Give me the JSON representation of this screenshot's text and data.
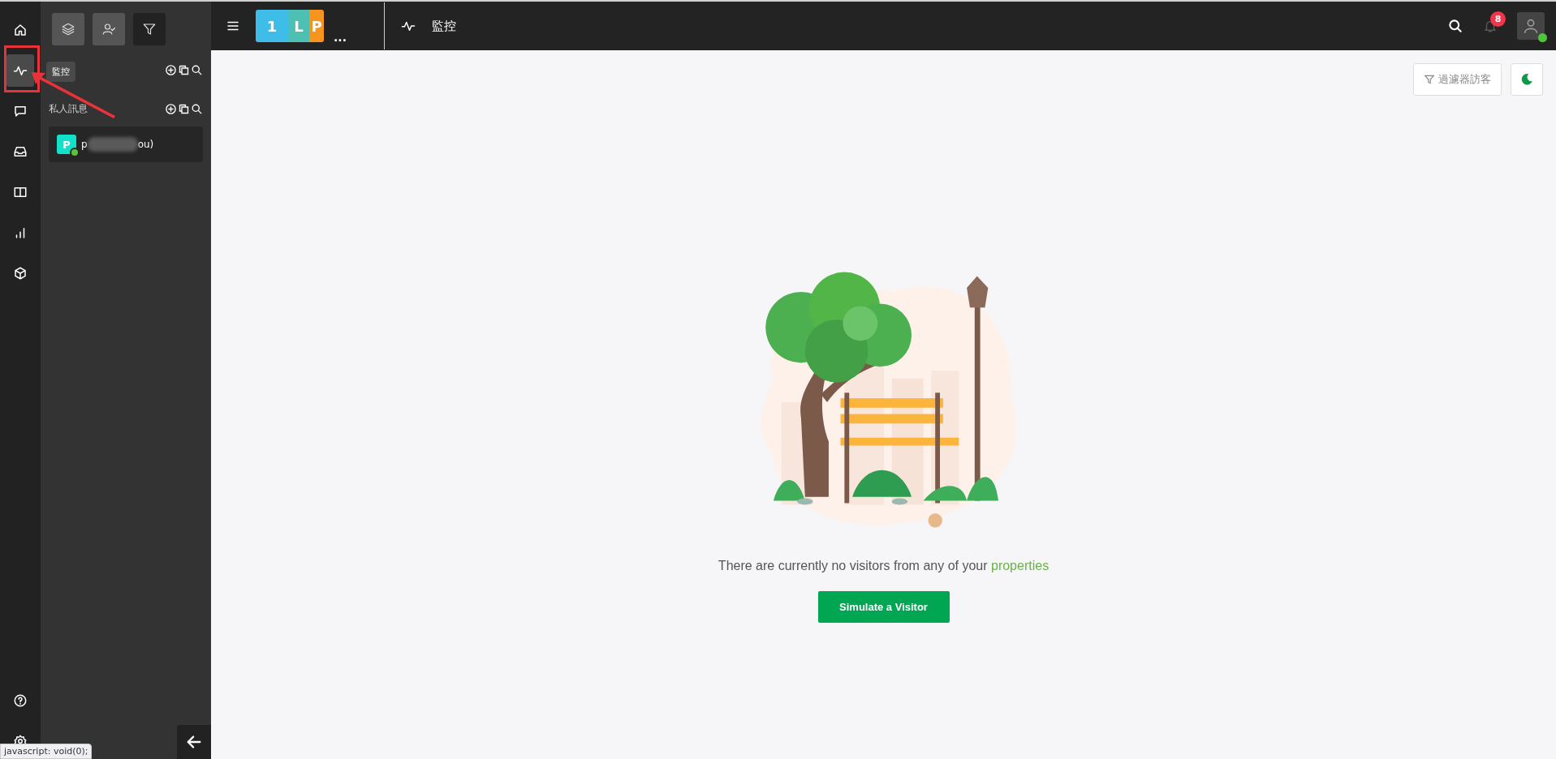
{
  "rail": {
    "items": [
      {
        "kind": "home",
        "selected": false
      },
      {
        "kind": "pulse",
        "selected": true
      },
      {
        "kind": "chat",
        "selected": false
      },
      {
        "kind": "inbox",
        "selected": false
      },
      {
        "kind": "book",
        "selected": false
      },
      {
        "kind": "chart",
        "selected": false
      },
      {
        "kind": "cube",
        "selected": false
      }
    ],
    "bottom_items": [
      {
        "kind": "help",
        "selected": false
      },
      {
        "kind": "settings",
        "selected": false
      }
    ]
  },
  "tooltip": "監控",
  "panel": {
    "tool_buttons": [
      {
        "kind": "layers",
        "on": true
      },
      {
        "kind": "user-check",
        "on": true
      },
      {
        "kind": "filter",
        "on": false
      }
    ],
    "sections": [
      {
        "title": "私人訊息",
        "conversations": [
          {
            "avatar": "P",
            "name_start": "p",
            "name_end": "ou)",
            "online": true
          }
        ]
      }
    ]
  },
  "topbar": {
    "logo": [
      {
        "letter": "1",
        "color": "#3fbde9"
      },
      {
        "letter": "L",
        "color": "#4dbfb3"
      },
      {
        "letter": "P",
        "color": "#f7941d"
      }
    ],
    "more": "...",
    "title": "監控",
    "notifications": "8"
  },
  "content": {
    "filter_button": "過濾器訪客",
    "message": "There are currently no visitors from any of your ",
    "message_link": "properties",
    "button": "Simulate a Visitor"
  },
  "status_url": "javascript: void(0);"
}
